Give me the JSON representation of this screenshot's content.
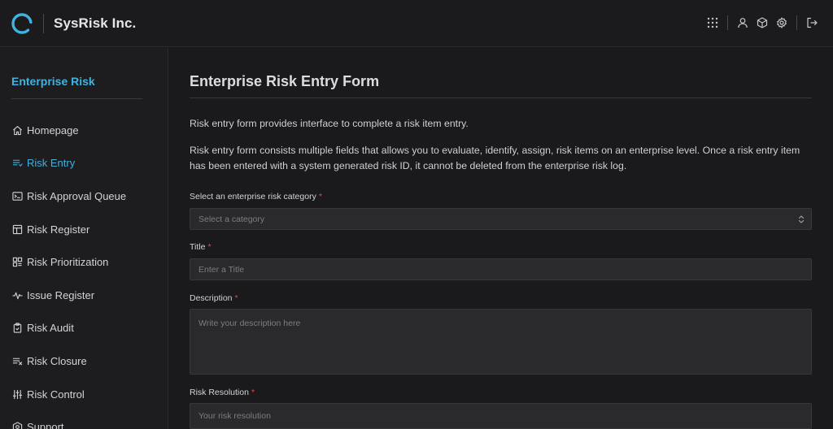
{
  "header": {
    "brand": "SysRisk Inc.",
    "icons": [
      "grid-icon",
      "user-icon",
      "cube-icon",
      "gear-icon",
      "logout-icon"
    ]
  },
  "sidebar": {
    "title": "Enterprise Risk",
    "items": [
      {
        "label": "Homepage",
        "icon": "home-icon",
        "active": false
      },
      {
        "label": "Risk Entry",
        "icon": "list-entry-icon",
        "active": true
      },
      {
        "label": "Risk Approval Queue",
        "icon": "terminal-icon",
        "active": false
      },
      {
        "label": "Risk Register",
        "icon": "table-icon",
        "active": false
      },
      {
        "label": "Risk Prioritization",
        "icon": "dashboard-icon",
        "active": false
      },
      {
        "label": "Issue Register",
        "icon": "activity-icon",
        "active": false
      },
      {
        "label": "Risk Audit",
        "icon": "clipboard-icon",
        "active": false
      },
      {
        "label": "Risk Closure",
        "icon": "list-close-icon",
        "active": false
      },
      {
        "label": "Risk Control",
        "icon": "sliders-icon",
        "active": false
      },
      {
        "label": "Support",
        "icon": "support-icon",
        "active": false
      }
    ]
  },
  "main": {
    "title": "Enterprise Risk Entry Form",
    "intro1": "Risk entry form provides interface to complete a risk item entry.",
    "intro2": "Risk entry form consists multiple fields that allows you to evaluate, identify, assign, risk items on an enterprise level. Once a risk entry item has been entered with a system generated risk ID, it cannot be deleted from the enterprise risk log.",
    "fields": {
      "category": {
        "label": "Select an enterprise risk category",
        "required": "*",
        "placeholder": "Select a category"
      },
      "title": {
        "label": "Title",
        "required": "*",
        "placeholder": "Enter a Title"
      },
      "description": {
        "label": "Description",
        "required": "*",
        "placeholder": "Write your description here"
      },
      "resolution": {
        "label": "Risk Resolution",
        "required": "*",
        "placeholder": "Your risk resolution"
      }
    }
  },
  "colors": {
    "accent": "#3fb2e0",
    "required": "#e5484d",
    "background": "#1a1a1c",
    "field": "#2a2a2d"
  }
}
